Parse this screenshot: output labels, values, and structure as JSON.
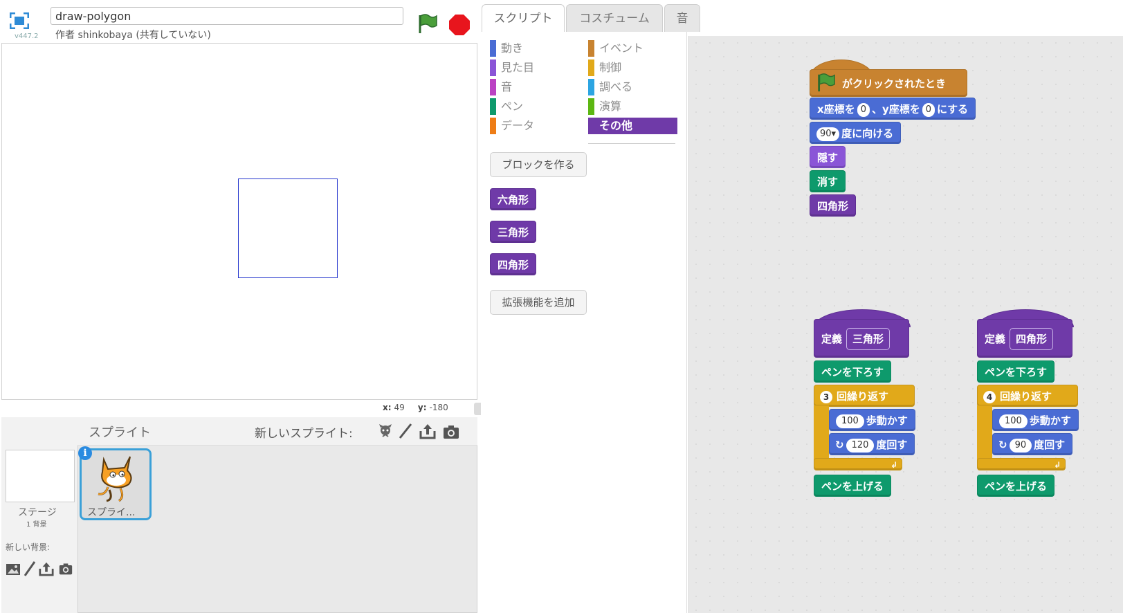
{
  "header": {
    "project_title": "draw-polygon",
    "version": "v447.2",
    "author": "作者 shinkobaya (共有していない)"
  },
  "stage": {
    "mouse_x_label": "x:",
    "mouse_x": "49",
    "mouse_y_label": "y:",
    "mouse_y": "-180"
  },
  "sprites_panel": {
    "title": "スプライト",
    "new_sprite_label": "新しいスプライト:",
    "stage_label": "ステージ",
    "stage_backdrops": "1 背景",
    "new_backdrop_label": "新しい背景:",
    "sprite_name": "スプライ...",
    "info_badge": "i"
  },
  "tabs": [
    {
      "label": "スクリプト",
      "active": true
    },
    {
      "label": "コスチューム",
      "active": false
    },
    {
      "label": "音",
      "active": false
    }
  ],
  "palette": {
    "categories_left": [
      {
        "label": "動き",
        "color": "#4a6cd4"
      },
      {
        "label": "見た目",
        "color": "#8a55d7"
      },
      {
        "label": "音",
        "color": "#bb42c3"
      },
      {
        "label": "ペン",
        "color": "#0e9a6c"
      },
      {
        "label": "データ",
        "color": "#ee7d16"
      }
    ],
    "categories_right": [
      {
        "label": "イベント",
        "color": "#c88330"
      },
      {
        "label": "制御",
        "color": "#e1a91a"
      },
      {
        "label": "調べる",
        "color": "#2ca5e2"
      },
      {
        "label": "演算",
        "color": "#5cb712"
      },
      {
        "label": "その他",
        "color": "#6f3aa8",
        "selected": true
      }
    ],
    "make_block_button": "ブロックを作る",
    "custom_blocks": [
      "六角形",
      "三角形",
      "四角形"
    ],
    "add_extension_button": "拡張機能を追加"
  },
  "scripts": {
    "main": {
      "hat": "がクリックされたとき",
      "goto_x_label": "x座標を",
      "goto_x": "0",
      "goto_sep": "、y座標を",
      "goto_y": "0",
      "goto_end": "にする",
      "direction": "90",
      "direction_label": "度に向ける",
      "hide": "隠す",
      "clear": "消す",
      "call": "四角形"
    },
    "triangle": {
      "define": "定義",
      "name": "三角形",
      "pen_down": "ペンを下ろす",
      "repeat_count": "3",
      "repeat_label": "回繰り返す",
      "move_steps": "100",
      "move_label": "歩動かす",
      "turn_degrees": "120",
      "turn_label": "度回す",
      "pen_up": "ペンを上げる"
    },
    "square": {
      "define": "定義",
      "name": "四角形",
      "pen_down": "ペンを下ろす",
      "repeat_count": "4",
      "repeat_label": "回繰り返す",
      "move_steps": "100",
      "move_label": "歩動かす",
      "turn_degrees": "90",
      "turn_label": "度回す",
      "pen_up": "ペンを上げる"
    }
  }
}
